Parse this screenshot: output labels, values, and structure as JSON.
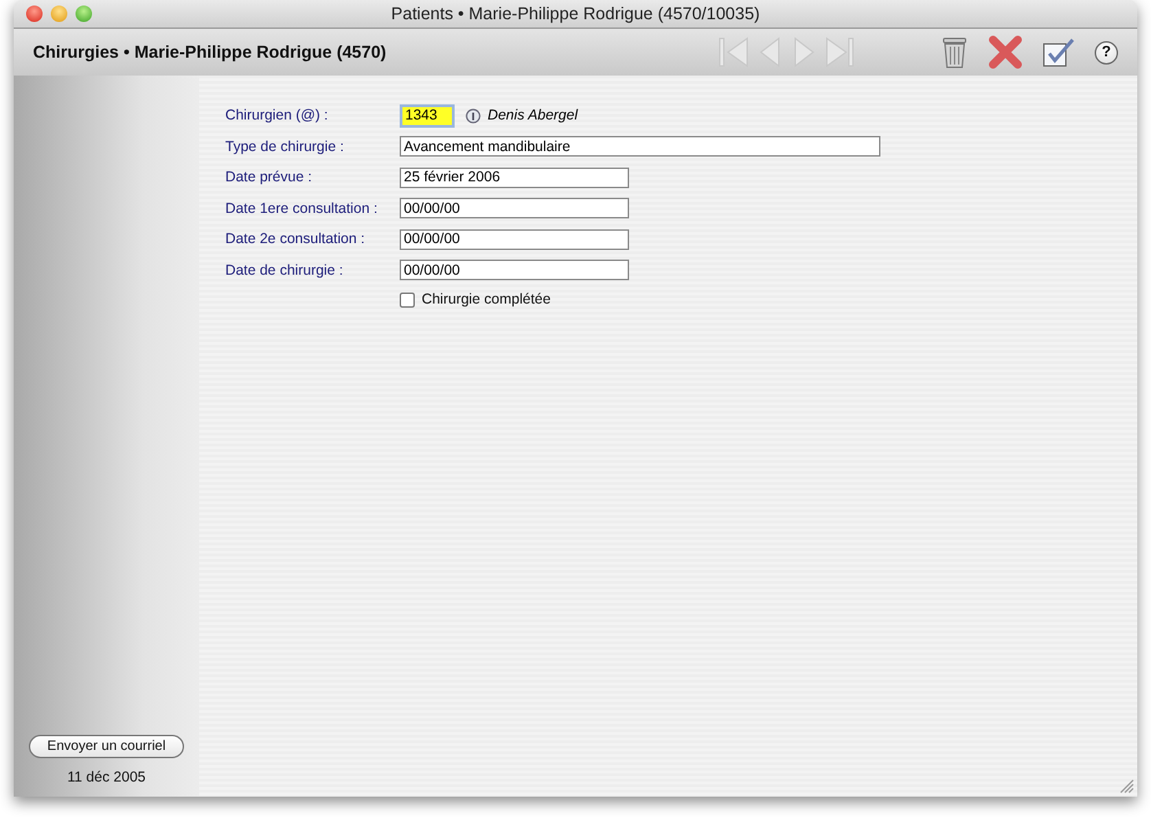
{
  "window": {
    "title": "Patients • Marie-Philippe Rodrigue (4570/10035)"
  },
  "toolbar": {
    "title": "Chirurgies • Marie-Philippe Rodrigue (4570)",
    "nav_buttons": [
      {
        "kind": "first",
        "disabled": true
      },
      {
        "kind": "prev",
        "disabled": true
      },
      {
        "kind": "next",
        "disabled": true
      },
      {
        "kind": "last",
        "disabled": true
      }
    ],
    "actions": [
      {
        "kind": "delete"
      },
      {
        "kind": "cancel"
      },
      {
        "kind": "validate"
      },
      {
        "kind": "help",
        "label": "?"
      }
    ]
  },
  "form": {
    "fields": [
      {
        "label": "Chirurgien (@) :",
        "value": "1343",
        "kind": "short",
        "highlighted": true,
        "info": "Denis Abergel"
      },
      {
        "label": "Type de chirurgie :",
        "value": "Avancement mandibulaire",
        "kind": "long",
        "highlighted": false
      },
      {
        "label": "Date prévue :",
        "value": "25 février 2006",
        "kind": "medium",
        "highlighted": false
      },
      {
        "label": "Date 1ere consultation :",
        "value": "00/00/00",
        "kind": "medium",
        "highlighted": false
      },
      {
        "label": "Date 2e consultation :",
        "value": "00/00/00",
        "kind": "medium",
        "highlighted": false
      },
      {
        "label": "Date de chirurgie :",
        "value": "00/00/00",
        "kind": "medium",
        "highlighted": false
      }
    ],
    "checkbox": {
      "label": "Chirurgie complétée",
      "checked": false
    }
  },
  "sidebar": {
    "button": "Envoyer un courriel",
    "date": "11 déc 2005"
  }
}
